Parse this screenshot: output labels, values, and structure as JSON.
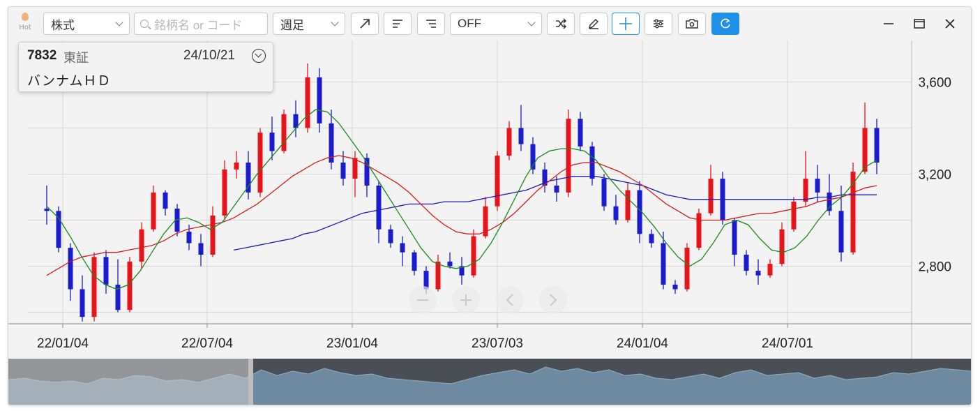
{
  "toolbar": {
    "hot_label": "Hot",
    "market_select": "株式",
    "search_placeholder": "銘柄名 or コード",
    "period_select": "週足",
    "indicator_select": "OFF"
  },
  "info_panel": {
    "code": "7832",
    "exchange": "東証",
    "date": "24/10/21",
    "name": "バンナムＨＤ"
  },
  "colors": {
    "up": "#e8141b",
    "down": "#1b1bd0",
    "ma_short": "#1a8a1a",
    "ma_mid": "#d81b1b",
    "ma_long": "#1c1cb8",
    "accent": "#1e90e8"
  },
  "chart_data": {
    "type": "candlestick",
    "x_ticks": [
      "22/01/04",
      "22/07/04",
      "23/01/04",
      "23/07/03",
      "24/01/04",
      "24/07/01"
    ],
    "y_ticks": [
      2800,
      3200,
      3600
    ],
    "ylim": [
      2550,
      3780
    ],
    "grid": true,
    "candles": [
      [
        3050,
        3150,
        2980,
        3040
      ],
      [
        3040,
        3060,
        2860,
        2880
      ],
      [
        2880,
        2900,
        2650,
        2700
      ],
      [
        2700,
        2760,
        2560,
        2580
      ],
      [
        2580,
        2860,
        2560,
        2840
      ],
      [
        2840,
        2870,
        2680,
        2720
      ],
      [
        2720,
        2830,
        2600,
        2610
      ],
      [
        2610,
        2840,
        2600,
        2820
      ],
      [
        2820,
        2990,
        2790,
        2960
      ],
      [
        2960,
        3150,
        2950,
        3120
      ],
      [
        3120,
        3130,
        3020,
        3050
      ],
      [
        3050,
        3070,
        2930,
        2950
      ],
      [
        2950,
        2980,
        2870,
        2900
      ],
      [
        2900,
        2940,
        2800,
        2850
      ],
      [
        2850,
        3060,
        2840,
        3020
      ],
      [
        3020,
        3260,
        3000,
        3220
      ],
      [
        3220,
        3300,
        3180,
        3250
      ],
      [
        3250,
        3300,
        3090,
        3120
      ],
      [
        3120,
        3400,
        3100,
        3380
      ],
      [
        3380,
        3450,
        3260,
        3300
      ],
      [
        3300,
        3480,
        3290,
        3460
      ],
      [
        3460,
        3520,
        3360,
        3400
      ],
      [
        3400,
        3680,
        3380,
        3620
      ],
      [
        3620,
        3660,
        3380,
        3420
      ],
      [
        3420,
        3480,
        3220,
        3250
      ],
      [
        3250,
        3300,
        3150,
        3180
      ],
      [
        3180,
        3300,
        3100,
        3270
      ],
      [
        3270,
        3290,
        3100,
        3150
      ],
      [
        3150,
        3170,
        2900,
        2960
      ],
      [
        2960,
        2980,
        2880,
        2900
      ],
      [
        2900,
        2930,
        2800,
        2860
      ],
      [
        2860,
        2870,
        2760,
        2780
      ],
      [
        2780,
        2800,
        2680,
        2700
      ],
      [
        2700,
        2850,
        2690,
        2820
      ],
      [
        2820,
        2860,
        2790,
        2800
      ],
      [
        2800,
        2840,
        2720,
        2760
      ],
      [
        2760,
        2960,
        2750,
        2930
      ],
      [
        2930,
        3100,
        2920,
        3060
      ],
      [
        3060,
        3300,
        3040,
        3280
      ],
      [
        3280,
        3430,
        3260,
        3400
      ],
      [
        3400,
        3500,
        3300,
        3330
      ],
      [
        3330,
        3360,
        3200,
        3220
      ],
      [
        3220,
        3250,
        3120,
        3150
      ],
      [
        3150,
        3190,
        3080,
        3120
      ],
      [
        3120,
        3480,
        3100,
        3440
      ],
      [
        3440,
        3470,
        3300,
        3320
      ],
      [
        3320,
        3340,
        3150,
        3180
      ],
      [
        3180,
        3200,
        3040,
        3060
      ],
      [
        3060,
        3110,
        2980,
        3000
      ],
      [
        3000,
        3160,
        2990,
        3130
      ],
      [
        3130,
        3170,
        2900,
        2940
      ],
      [
        2940,
        2960,
        2880,
        2900
      ],
      [
        2900,
        2950,
        2700,
        2720
      ],
      [
        2720,
        2740,
        2680,
        2700
      ],
      [
        2700,
        2900,
        2690,
        2880
      ],
      [
        2880,
        3050,
        2870,
        3030
      ],
      [
        3030,
        3240,
        3020,
        3180
      ],
      [
        3180,
        3210,
        2980,
        3000
      ],
      [
        3000,
        3010,
        2800,
        2850
      ],
      [
        2850,
        2870,
        2760,
        2780
      ],
      [
        2780,
        2830,
        2720,
        2760
      ],
      [
        2760,
        2830,
        2750,
        2810
      ],
      [
        2810,
        2990,
        2800,
        2960
      ],
      [
        2960,
        3100,
        2950,
        3080
      ],
      [
        3080,
        3300,
        3060,
        3180
      ],
      [
        3180,
        3240,
        3080,
        3120
      ],
      [
        3120,
        3200,
        3020,
        3040
      ],
      [
        3040,
        3150,
        2820,
        2860
      ],
      [
        2860,
        3250,
        2850,
        3210
      ],
      [
        3210,
        3510,
        3200,
        3400
      ],
      [
        3400,
        3440,
        3200,
        3250
      ]
    ],
    "ma_short": [
      3060,
      3010,
      2930,
      2840,
      2760,
      2720,
      2700,
      2720,
      2780,
      2860,
      2940,
      3000,
      3010,
      2990,
      2960,
      2990,
      3060,
      3130,
      3200,
      3260,
      3320,
      3380,
      3440,
      3480,
      3470,
      3420,
      3350,
      3280,
      3200,
      3120,
      3040,
      2960,
      2880,
      2820,
      2800,
      2790,
      2800,
      2830,
      2900,
      2990,
      3090,
      3190,
      3270,
      3300,
      3310,
      3310,
      3300,
      3260,
      3190,
      3130,
      3080,
      3030,
      2970,
      2900,
      2840,
      2800,
      2830,
      2900,
      2980,
      3000,
      2980,
      2920,
      2870,
      2860,
      2880,
      2930,
      3000,
      3060,
      3100,
      3160,
      3230,
      3260
    ],
    "ma_mid": [
      2760,
      2790,
      2820,
      2840,
      2850,
      2860,
      2860,
      2870,
      2880,
      2890,
      2910,
      2940,
      2960,
      2970,
      2980,
      2990,
      3010,
      3040,
      3070,
      3110,
      3150,
      3190,
      3220,
      3250,
      3270,
      3280,
      3270,
      3250,
      3220,
      3190,
      3160,
      3120,
      3070,
      3020,
      2980,
      2950,
      2940,
      2940,
      2960,
      2990,
      3030,
      3080,
      3130,
      3170,
      3210,
      3240,
      3250,
      3250,
      3230,
      3210,
      3180,
      3150,
      3110,
      3070,
      3040,
      3010,
      3000,
      3000,
      3000,
      3010,
      3020,
      3030,
      3030,
      3040,
      3050,
      3060,
      3080,
      3090,
      3100,
      3120,
      3140,
      3150
    ],
    "ma_long": [
      null,
      null,
      null,
      null,
      null,
      null,
      null,
      null,
      null,
      null,
      null,
      null,
      null,
      null,
      null,
      null,
      2870,
      2880,
      2890,
      2900,
      2910,
      2920,
      2940,
      2950,
      2970,
      2990,
      3010,
      3030,
      3040,
      3050,
      3060,
      3070,
      3070,
      3070,
      3080,
      3080,
      3080,
      3090,
      3100,
      3110,
      3120,
      3130,
      3150,
      3170,
      3180,
      3190,
      3190,
      3190,
      3180,
      3170,
      3160,
      3150,
      3130,
      3110,
      3100,
      3090,
      3090,
      3090,
      3090,
      3090,
      3090,
      3090,
      3090,
      3090,
      3090,
      3090,
      3100,
      3100,
      3110,
      3110,
      3110,
      3110
    ]
  },
  "navigator": {
    "series": [
      0.55,
      0.6,
      0.5,
      0.45,
      0.5,
      0.4,
      0.6,
      0.55,
      0.7,
      0.65,
      0.5,
      0.55,
      0.45,
      0.6,
      0.75,
      0.6,
      0.9,
      0.7,
      0.85,
      0.75,
      0.95,
      0.8,
      0.7,
      0.75,
      0.6,
      0.55,
      0.5,
      0.45,
      0.4,
      0.55,
      0.7,
      0.8,
      0.9,
      0.75,
      1.0,
      0.85,
      0.95,
      0.8,
      0.9,
      0.7,
      0.75,
      0.6,
      0.55,
      0.65,
      0.75,
      0.6,
      0.8,
      0.9,
      0.7,
      0.75,
      0.8,
      0.6,
      0.7,
      0.55,
      0.6,
      0.65,
      0.8,
      0.75,
      0.85,
      0.95,
      0.9,
      0.85
    ]
  }
}
